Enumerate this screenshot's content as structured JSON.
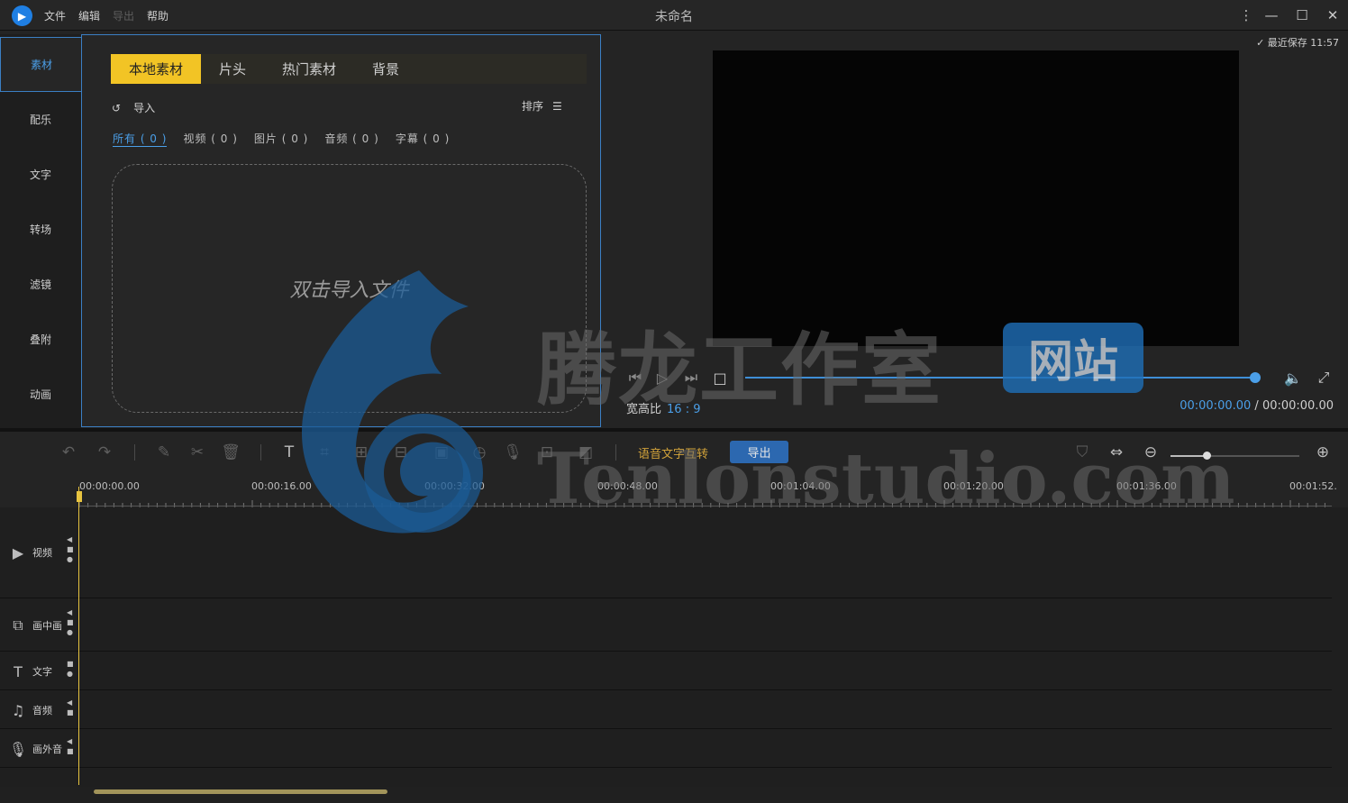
{
  "titlebar": {
    "menus": [
      "文件",
      "编辑",
      "导出",
      "帮助"
    ],
    "title": "未命名",
    "logo_glyph": "▶"
  },
  "sidebar": {
    "items": [
      "素材",
      "配乐",
      "文字",
      "转场",
      "滤镜",
      "叠附",
      "动画"
    ],
    "active_index": 0
  },
  "media_panel": {
    "tabs": [
      "本地素材",
      "片头",
      "热门素材",
      "背景"
    ],
    "active_tab": 0,
    "import_label": "导入",
    "sort_label": "排序",
    "filters": [
      "所有 ( 0 )",
      "视频 ( 0 )",
      "图片 ( 0 )",
      "音频 ( 0 )",
      "字幕 ( 0 )"
    ],
    "dropzone_text": "双击导入文件"
  },
  "preview": {
    "autosave": "最近保存 11:57",
    "ratio_label": "宽高比",
    "ratio_value": "16 : 9",
    "current_time": "00:00:00.00",
    "time_separator": " / ",
    "total_time": "00:00:00.00",
    "progress": 1.0
  },
  "toolbar": {
    "speech_label": "语音文字互转",
    "export_label": "导出",
    "zoom_level": 0.28
  },
  "timeline": {
    "ruler_labels": [
      "00:00:00.00",
      "00:00:16.00",
      "00:00:32.00",
      "00:00:48.00",
      "00:01:04.00",
      "00:01:20.00",
      "00:01:36.00",
      "00:01:52."
    ],
    "tracks": [
      {
        "label": "视频",
        "icon": "video-icon"
      },
      {
        "label": "画中画",
        "icon": "pip-icon"
      },
      {
        "label": "文字",
        "icon": "text-icon"
      },
      {
        "label": "音频",
        "icon": "music-icon"
      },
      {
        "label": "画外音",
        "icon": "mic-icon"
      }
    ]
  },
  "watermark": {
    "cn": "腾龙工作室",
    "badge": "网站",
    "en": "Tenlonstudio.com"
  },
  "colors": {
    "accent_blue": "#4b9fe8",
    "tab_yellow": "#f2c425",
    "export_blue": "#2c68b0",
    "playhead": "#e8c440"
  }
}
